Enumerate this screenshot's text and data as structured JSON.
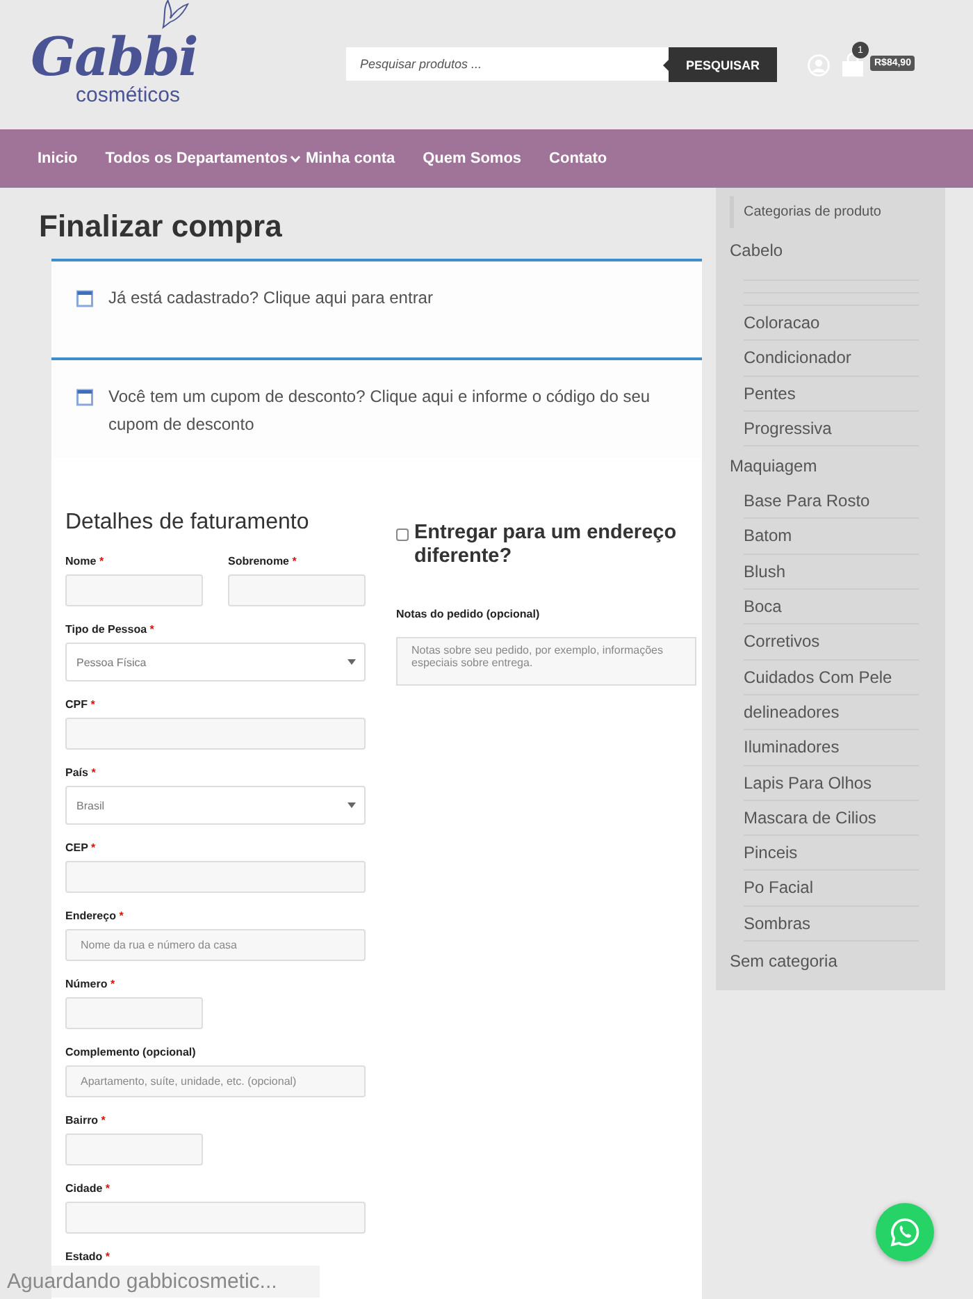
{
  "header": {
    "logo": {
      "name": "Gabbi",
      "tagline": "cosméticos"
    },
    "search": {
      "placeholder": "Pesquisar produtos ...",
      "button": "PESQUISAR"
    },
    "cart": {
      "count": "1",
      "total": "R$84,90"
    }
  },
  "nav": [
    {
      "label": "Inicio",
      "has_menu": false
    },
    {
      "label": "Todos os Departamentos",
      "has_menu": true
    },
    {
      "label": "Minha conta",
      "has_menu": false
    },
    {
      "label": "Quem Somos",
      "has_menu": false
    },
    {
      "label": "Contato",
      "has_menu": false
    }
  ],
  "page_title": "Finalizar compra",
  "notices": [
    {
      "text": "Já está cadastrado? Clique aqui para entrar"
    },
    {
      "text": "Você tem um cupom de desconto? Clique aqui e informe o código do seu cupom de desconto"
    }
  ],
  "billing": {
    "title": "Detalhes de faturamento",
    "rows": [
      [
        {
          "label": "Nome",
          "mark": "*",
          "kind": "short"
        },
        {
          "label": "Sobrenome",
          "mark": "*",
          "kind": "short"
        }
      ],
      [
        {
          "label": "Tipo de Pessoa",
          "mark": "*",
          "kind": "select",
          "value": "Pessoa Física"
        }
      ],
      [
        {
          "label": "CPF",
          "mark": "*",
          "kind": "text"
        }
      ],
      [
        {
          "label": "País",
          "mark": "*",
          "kind": "select",
          "value": "Brasil"
        }
      ],
      [
        {
          "label": "CEP",
          "mark": "*",
          "kind": "text"
        }
      ],
      [
        {
          "label": "Endereço",
          "mark": "*",
          "kind": "text",
          "placeholder": "Nome da rua e número da casa"
        }
      ],
      [
        {
          "label": "Número",
          "mark": "*",
          "kind": "short"
        }
      ],
      [
        {
          "label": "Complemento (opcional)",
          "kind": "text",
          "placeholder": "Apartamento, suíte, unidade, etc. (opcional)"
        }
      ],
      [
        {
          "label": "Bairro",
          "mark": "*",
          "kind": "short"
        }
      ],
      [
        {
          "label": "Cidade",
          "mark": "*",
          "kind": "text"
        }
      ],
      [
        {
          "label": "Estado",
          "mark": "*",
          "kind": "label"
        }
      ]
    ]
  },
  "shipping": {
    "title": "Entregar para um endereço diferente?",
    "checked": false,
    "notes_label": "Notas do pedido (opcional)",
    "notes_placeholder": "Notas sobre seu pedido, por exemplo, informações especiais sobre entrega."
  },
  "sidebar": {
    "title": "Categorias de produto",
    "categories": [
      {
        "label": "Cabelo",
        "children": [
          "Coloracao",
          "Condicionador",
          "Pentes",
          "Progressiva"
        ]
      },
      {
        "label": "Maquiagem",
        "children": [
          "Base Para Rosto",
          "Batom",
          "Blush",
          "Boca",
          "Corretivos",
          "Cuidados Com Pele",
          "delineadores",
          "Iluminadores",
          "Lapis Para Olhos",
          "Mascara de Cilios",
          "Pinceis",
          "Po Facial",
          "Sombras"
        ]
      },
      {
        "label": "Sem categoria"
      }
    ]
  },
  "status_bar": "Aguardando gabbicosmetic..."
}
